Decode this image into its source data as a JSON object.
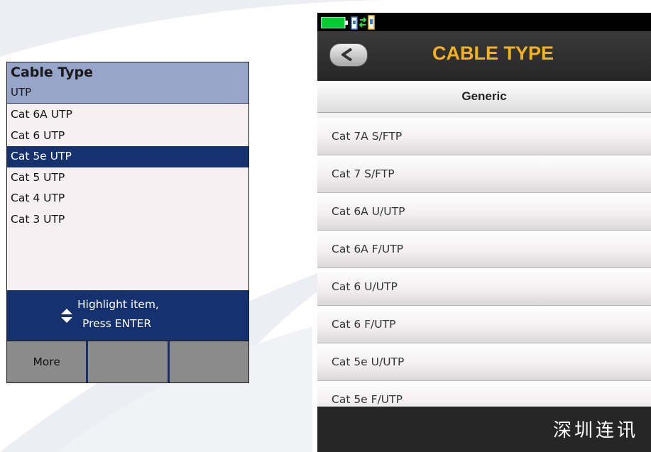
{
  "left": {
    "title": "Cable Type",
    "subtitle": "UTP",
    "items": [
      {
        "label": "Cat 6A UTP",
        "selected": false
      },
      {
        "label": "Cat 6 UTP",
        "selected": false
      },
      {
        "label": "Cat 5e UTP",
        "selected": true
      },
      {
        "label": "Cat 5 UTP",
        "selected": false
      },
      {
        "label": "Cat 4 UTP",
        "selected": false
      },
      {
        "label": "Cat 3 UTP",
        "selected": false
      }
    ],
    "hint_line1": "Highlight item,",
    "hint_line2": "Press ENTER",
    "hint_icon": "updown-arrows-icon",
    "softkeys": [
      "More",
      "",
      ""
    ],
    "colors": {
      "header": "#97a5c9",
      "selection": "#15316e",
      "softkey": "#8b8b8b"
    }
  },
  "right": {
    "title": "CABLE TYPE",
    "group": "Generic",
    "items": [
      "Cat 7A S/FTP",
      "Cat 7 S/FTP",
      "Cat 6A U/UTP",
      "Cat 6A F/UTP",
      "Cat 6 U/UTP",
      "Cat 6 F/UTP",
      "Cat 5e U/UTP",
      "Cat 5e F/UTP"
    ],
    "status_icons": [
      "battery-icon",
      "link-status-icon"
    ],
    "back_icon": "chevron-left-icon",
    "watermark": "深圳连讯",
    "colors": {
      "title": "#f5b21b",
      "titlebar": "#262626",
      "battery": "#00cc33"
    }
  }
}
